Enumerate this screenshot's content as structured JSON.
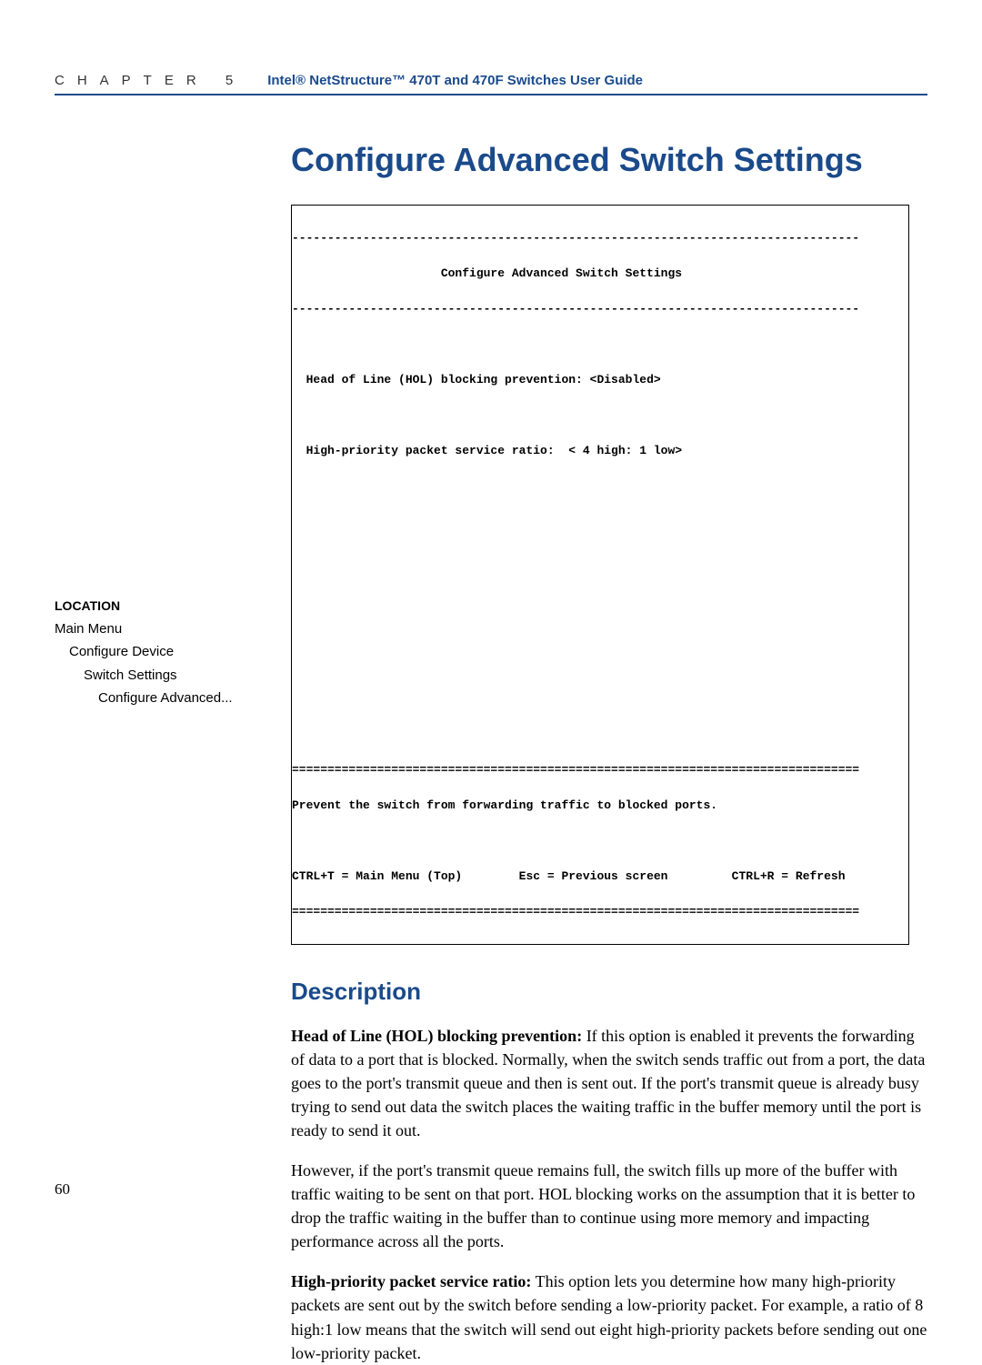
{
  "header": {
    "chapter_label": "CHAPTER 5",
    "guide_title": "Intel® NetStructure™ 470T and 470F Switches User Guide"
  },
  "main_title": "Configure Advanced Switch Settings",
  "terminal": {
    "dash_line": "--------------------------------------------------------------------------------",
    "title": "                     Configure Advanced Switch Settings",
    "hol_line": "  Head of Line (HOL) blocking prevention: <Disabled>",
    "ratio_line": "  High-priority packet service ratio:  < 4 high: 1 low>",
    "eq_line": "================================================================================",
    "help_line": "Prevent the switch from forwarding traffic to blocked ports.",
    "footer_line": "CTRL+T = Main Menu (Top)        Esc = Previous screen         CTRL+R = Refresh"
  },
  "section_heading": "Description",
  "sidebar": {
    "header": "LOCATION",
    "l1": "Main Menu",
    "l2": "Configure Device",
    "l3": "Switch Settings",
    "l4": "Configure Advanced..."
  },
  "body": {
    "p1_bold": "Head of Line (HOL) blocking prevention:",
    "p1_rest": " If this option is enabled it prevents the forwarding of data to a port that is blocked. Normally, when the switch sends traffic out from a port, the data goes to the port's transmit queue and then is sent out. If the port's transmit queue is already busy trying to send out data the switch places the waiting traffic in the buffer memory until the port is ready to send it out.",
    "p2": "However, if the port's transmit queue remains full, the switch fills up more of the buffer with traffic waiting to be sent on that port. HOL blocking works on the assumption that it is better to drop the traffic waiting in the buffer than to continue using more memory and impacting performance across all the ports.",
    "p3_bold": "High-priority packet service ratio:",
    "p3_rest": " This option lets you determine how many high-priority packets are sent out by the switch before sending a low-priority packet. For example, a ratio of 8 high:1 low means that the switch will send out eight high-priority packets before sending out one low-priority packet."
  },
  "page_num": "60"
}
